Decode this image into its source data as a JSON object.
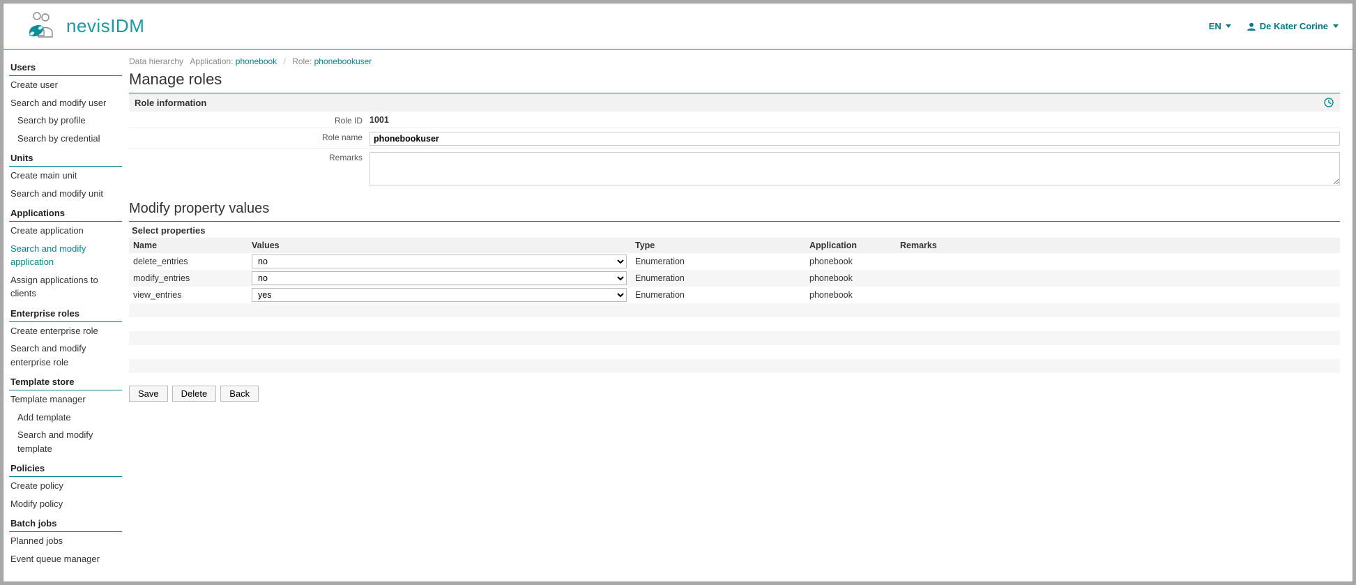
{
  "header": {
    "brand": "nevisIDM",
    "language": "EN",
    "user": "De Kater Corine"
  },
  "sidebar": {
    "groups": [
      {
        "title": "Users",
        "items": [
          {
            "label": "Create user"
          },
          {
            "label": "Search and modify user"
          },
          {
            "label": "Search by profile",
            "sub": true
          },
          {
            "label": "Search by credential",
            "sub": true
          }
        ]
      },
      {
        "title": "Units",
        "items": [
          {
            "label": "Create main unit"
          },
          {
            "label": "Search and modify unit"
          }
        ]
      },
      {
        "title": "Applications",
        "items": [
          {
            "label": "Create application"
          },
          {
            "label": "Search and modify application",
            "active": true
          },
          {
            "label": "Assign applications to clients"
          }
        ]
      },
      {
        "title": "Enterprise roles",
        "items": [
          {
            "label": "Create enterprise role"
          },
          {
            "label": "Search and modify enterprise role"
          }
        ]
      },
      {
        "title": "Template store",
        "items": [
          {
            "label": "Template manager"
          },
          {
            "label": "Add template",
            "sub": true
          },
          {
            "label": "Search and modify template",
            "sub": true
          }
        ]
      },
      {
        "title": "Policies",
        "items": [
          {
            "label": "Create policy"
          },
          {
            "label": "Modify policy"
          }
        ]
      },
      {
        "title": "Batch jobs",
        "items": [
          {
            "label": "Planned jobs"
          },
          {
            "label": "Event queue manager"
          }
        ]
      }
    ]
  },
  "breadcrumb": {
    "root": "Data hierarchy",
    "app_label": "Application:",
    "app_value": "phonebook",
    "role_label": "Role:",
    "role_value": "phonebookuser"
  },
  "page": {
    "title": "Manage roles",
    "role_info_header": "Role information",
    "role_id_label": "Role ID",
    "role_id_value": "1001",
    "role_name_label": "Role name",
    "role_name_value": "phonebookuser",
    "remarks_label": "Remarks",
    "remarks_value": "",
    "modify_title": "Modify property values",
    "select_properties_header": "Select properties",
    "columns": {
      "name": "Name",
      "values": "Values",
      "type": "Type",
      "application": "Application",
      "remarks": "Remarks"
    },
    "rows": [
      {
        "name": "delete_entries",
        "value": "no",
        "type": "Enumeration",
        "application": "phonebook",
        "remarks": ""
      },
      {
        "name": "modify_entries",
        "value": "no",
        "type": "Enumeration",
        "application": "phonebook",
        "remarks": ""
      },
      {
        "name": "view_entries",
        "value": "yes",
        "type": "Enumeration",
        "application": "phonebook",
        "remarks": ""
      }
    ],
    "buttons": {
      "save": "Save",
      "delete": "Delete",
      "back": "Back"
    }
  }
}
